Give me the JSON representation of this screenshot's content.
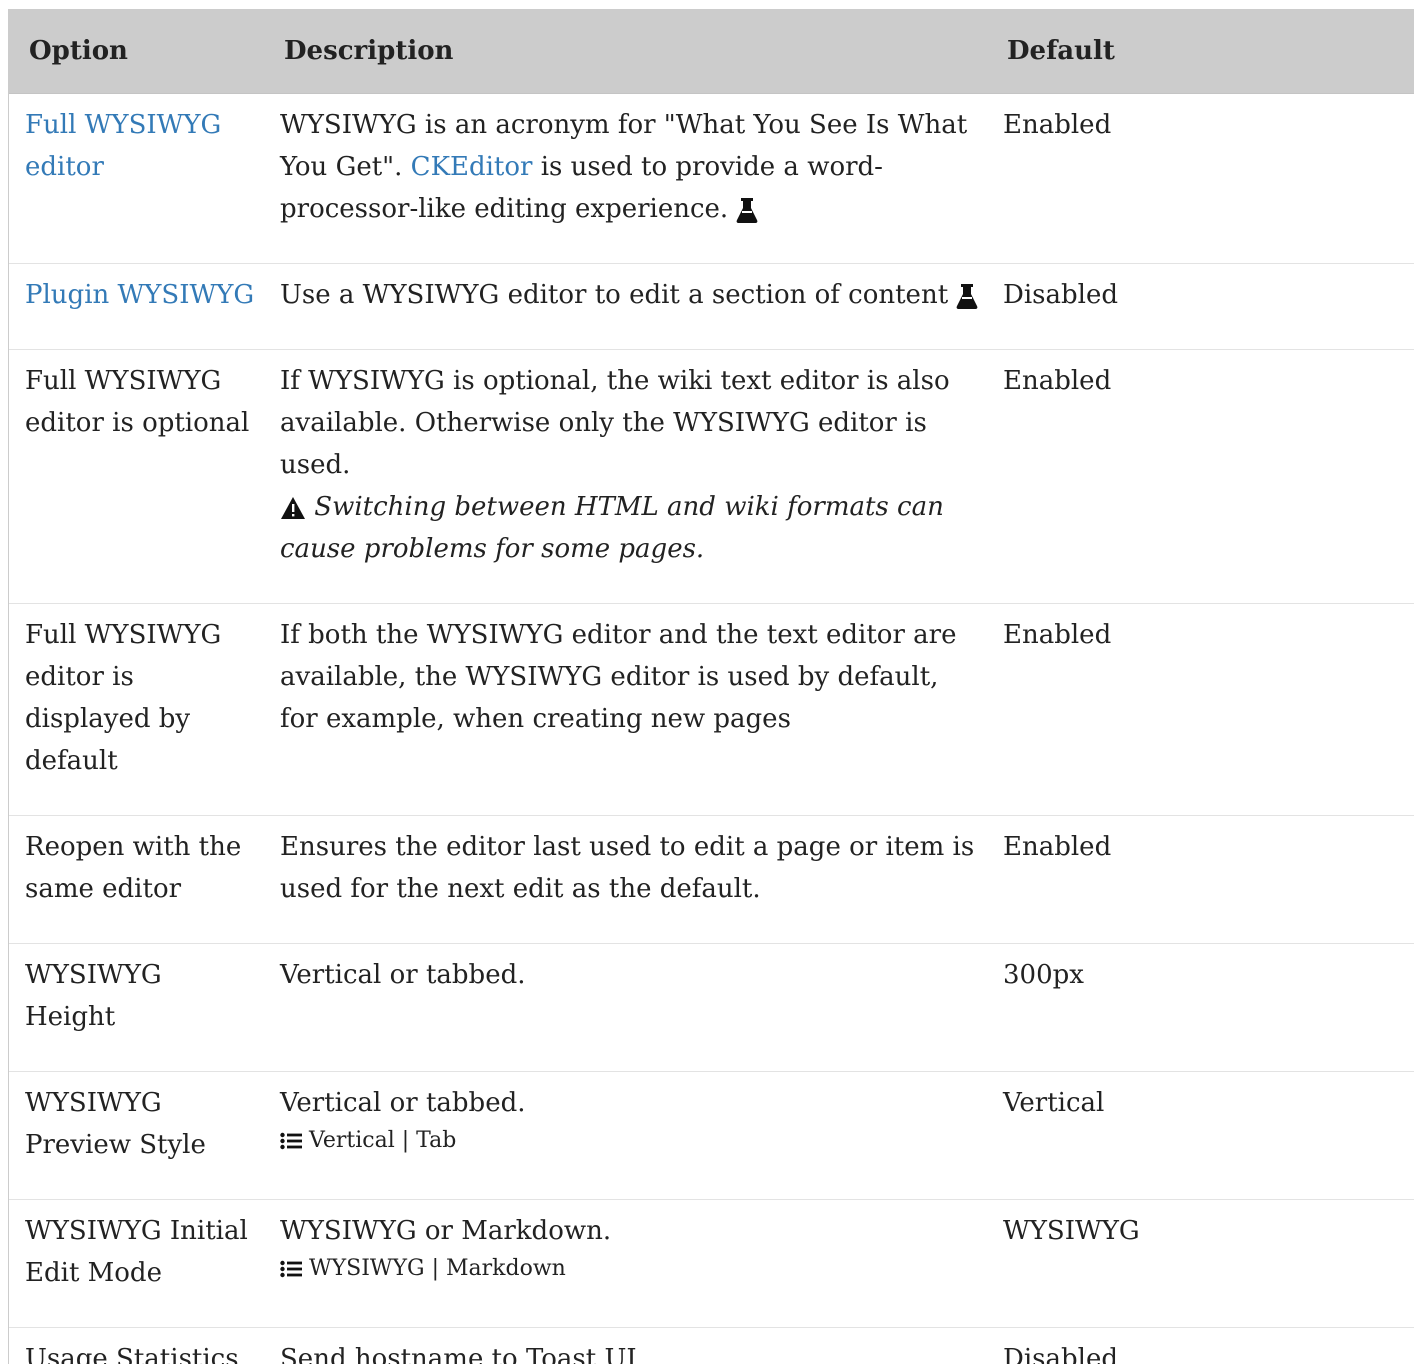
{
  "table": {
    "headers": {
      "option": "Option",
      "description": "Description",
      "default": "Default"
    },
    "rows": [
      {
        "option": "Full WYSIWYG editor",
        "option_is_link": true,
        "desc_part1": "WYSIWYG is an acronym for \"What You See Is What You Get\". ",
        "desc_link": "CKEditor",
        "desc_part2": " is used to provide a word-processor-like editing experience. ",
        "icon": "flask-icon",
        "default": "Enabled"
      },
      {
        "option": "Plugin WYSIWYG",
        "option_is_link": true,
        "desc_part1": "Use a WYSIWYG editor to edit a section of content ",
        "icon": "flask-icon",
        "default": "Disabled"
      },
      {
        "option": "Full WYSIWYG editor is optional",
        "desc_part1": "If WYSIWYG is optional, the wiki text editor is also available. Otherwise only the WYSIWYG editor is used.",
        "warning_icon": "warning-icon",
        "warning": "Switching between HTML and wiki formats can cause problems for some pages.",
        "default": "Enabled"
      },
      {
        "option": "Full WYSIWYG editor is displayed by default",
        "desc_part1": "If both the WYSIWYG editor and the text editor are available, the WYSIWYG editor is used by default, for example, when creating new pages",
        "default": "Enabled"
      },
      {
        "option": "Reopen with the same editor",
        "desc_part1": "Ensures the editor last used to edit a page or item is used for the next edit as the default.",
        "default": "Enabled"
      },
      {
        "option": "WYSIWYG Height",
        "desc_part1": "Vertical or tabbed.",
        "default": "300px"
      },
      {
        "option": "WYSIWYG Preview Style",
        "desc_part1": "Vertical or tabbed.",
        "list_icon": "list-icon",
        "options_hint": "Vertical | Tab",
        "default": "Vertical"
      },
      {
        "option": "WYSIWYG Initial Edit Mode",
        "desc_part1": "WYSIWYG or Markdown.",
        "list_icon": "list-icon",
        "options_hint": "WYSIWYG | Markdown",
        "default": "WYSIWYG"
      },
      {
        "option": "Usage Statistics",
        "desc_part1": "Send hostname to Toast UI.",
        "default": "Disabled"
      }
    ]
  },
  "colors": {
    "header_bg": "#cccccc",
    "link": "#337ab7",
    "text": "#222222"
  }
}
